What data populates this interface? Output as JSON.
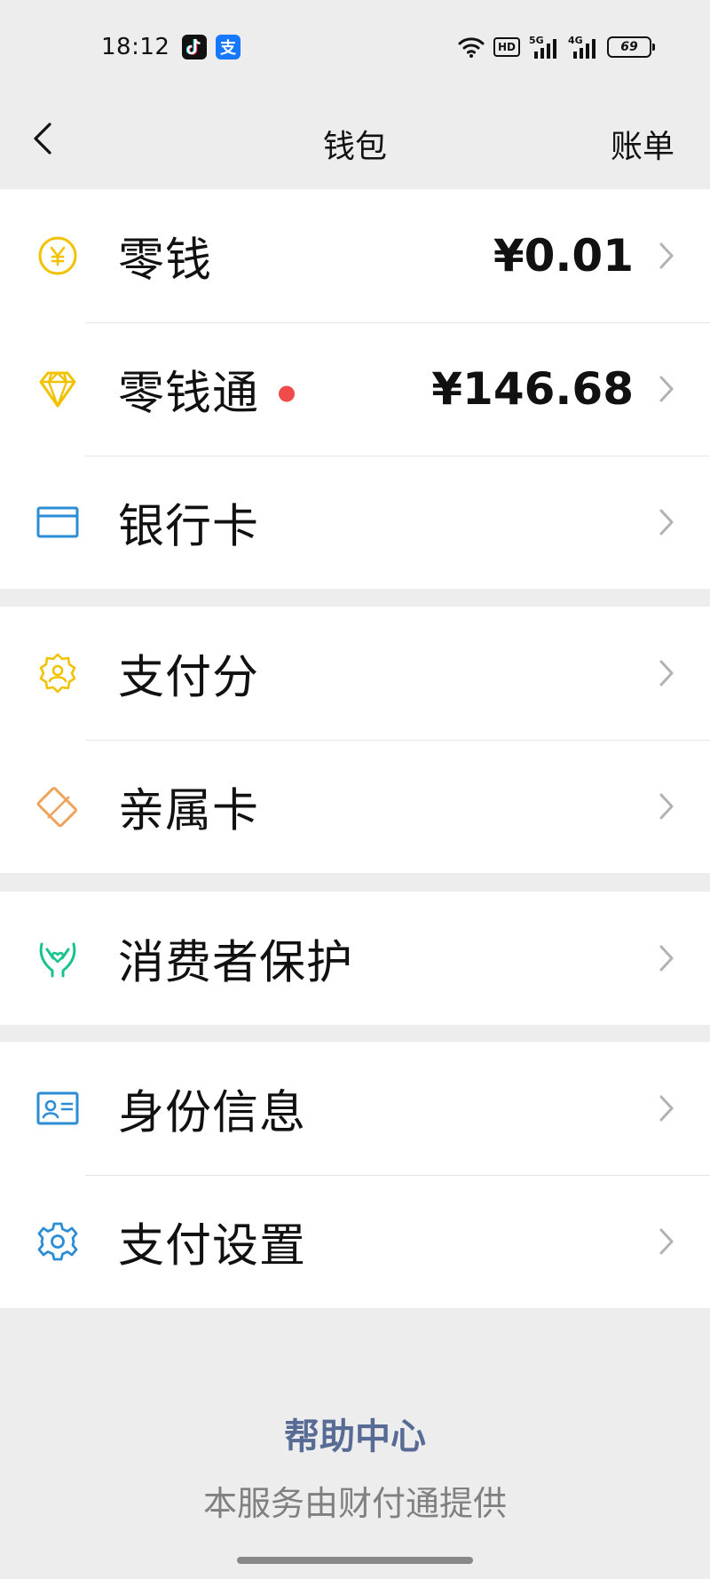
{
  "status_bar": {
    "time": "18:12",
    "hd": "HD",
    "net1": "5G",
    "net2": "4G",
    "battery": "69",
    "app_icons": [
      "tiktok-icon",
      "alipay-icon"
    ],
    "alipay_glyph": "支"
  },
  "nav": {
    "title": "钱包",
    "action": "账单"
  },
  "groups": [
    {
      "items": [
        {
          "label": "零钱",
          "value": "¥0.01",
          "icon": "yuan-coin-icon",
          "color": "#f2c200"
        },
        {
          "label": "零钱通",
          "value": "¥146.68",
          "icon": "diamond-icon",
          "color": "#f2c200",
          "dot": true
        },
        {
          "label": "银行卡",
          "icon": "bank-card-icon",
          "color": "#2b8dd6"
        }
      ]
    },
    {
      "items": [
        {
          "label": "支付分",
          "icon": "credit-score-icon",
          "color": "#f2c200"
        },
        {
          "label": "亲属卡",
          "icon": "family-card-icon",
          "color": "#f0a35a"
        }
      ]
    },
    {
      "items": [
        {
          "label": "消费者保护",
          "icon": "protect-hands-icon",
          "color": "#19c38e"
        }
      ]
    },
    {
      "items": [
        {
          "label": "身份信息",
          "icon": "id-card-icon",
          "color": "#2b8dd6"
        },
        {
          "label": "支付设置",
          "icon": "settings-gear-icon",
          "color": "#2b8dd6"
        }
      ]
    }
  ],
  "footer": {
    "help": "帮助中心",
    "provider": "本服务由财付通提供"
  }
}
